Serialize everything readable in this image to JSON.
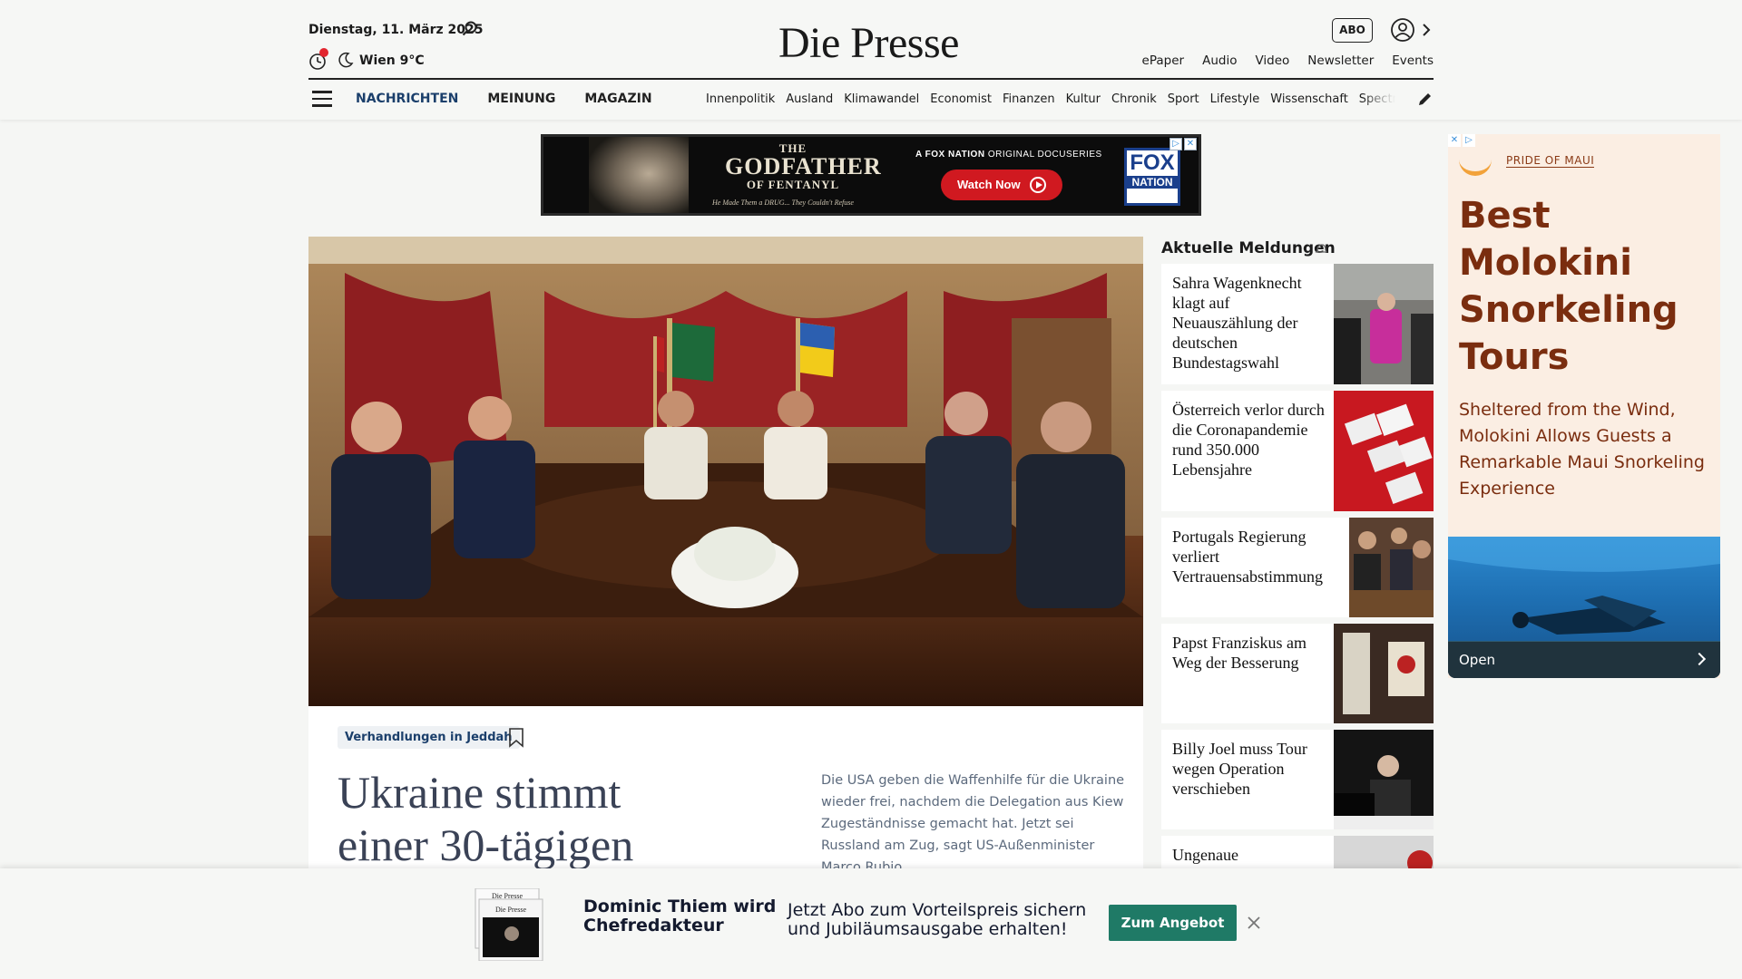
{
  "header": {
    "date": "Dienstag, 11. März 2025",
    "weather": "Wien 9°C",
    "logo": "Die Presse",
    "abo_label": "ABO",
    "top_links": [
      "ePaper",
      "Audio",
      "Video",
      "Newsletter",
      "Events"
    ],
    "main_nav": [
      "NACHRICHTEN",
      "MEINUNG",
      "MAGAZIN"
    ],
    "sub_nav": [
      "Innenpolitik",
      "Ausland",
      "Klimawandel",
      "Economist",
      "Finanzen",
      "Kultur",
      "Chronik",
      "Sport",
      "Lifestyle",
      "Wissenschaft",
      "Spectrum"
    ]
  },
  "top_ad": {
    "title_line1": "THE",
    "title_line2": "GODFATHER",
    "title_line3": "OF FENTANYL",
    "tagline": "He Made Them a DRUG... They Couldn't Refuse",
    "network_bold": "A FOX NATION",
    "network_rest": " ORIGINAL DOCUSERIES",
    "cta": "Watch Now",
    "logo_top": "FOX",
    "logo_bottom": "NATION"
  },
  "hero": {
    "tag": "Verhandlungen in Jeddah",
    "title": "Ukraine stimmt einer 30-tägigen",
    "lead": "Die USA geben die Waffenhilfe für die Ukraine wieder frei, nachdem die Delegation aus Kiew Zugeständnisse gemacht hat. Jetzt sei Russland am Zug, sagt US-Außenminister Marco Rubio."
  },
  "news": {
    "heading": "Aktuelle Meldungen",
    "items": [
      {
        "title": "Sahra Wagenknecht klagt auf Neuauszählung der deutschen Bundestagswahl"
      },
      {
        "title": "Österreich verlor durch die Coronapandemie rund 350.000 Lebensjahre"
      },
      {
        "title": "Portugals Regierung verliert Vertrauensabstimmung"
      },
      {
        "title": "Papst Franziskus am Weg der Besserung"
      },
      {
        "title": "Billy Joel muss Tour wegen Operation verschieben"
      },
      {
        "title": "Ungenaue"
      }
    ]
  },
  "side_ad": {
    "brand": "PRIDE OF MAUI",
    "headline": "Best Molokini Snorkeling Tours",
    "description": "Sheltered from the Wind, Molokini Allows Guests a Remarkable Maui Snorkeling Experience",
    "open_label": "Open"
  },
  "banner": {
    "name": "Dominic Thiem wird Chefredakteur",
    "offer": "Jetzt Abo zum Vorteilspreis sichern und Jubiläumsausgabe erhalten!",
    "cta": "Zum Angebot",
    "paper_label": "Die Presse"
  },
  "colors": {
    "nav_accent": "#1b3f6b",
    "cta_green": "#1f7a66",
    "ad_red": "#d01920",
    "maui_brown": "#7a2d0f"
  }
}
